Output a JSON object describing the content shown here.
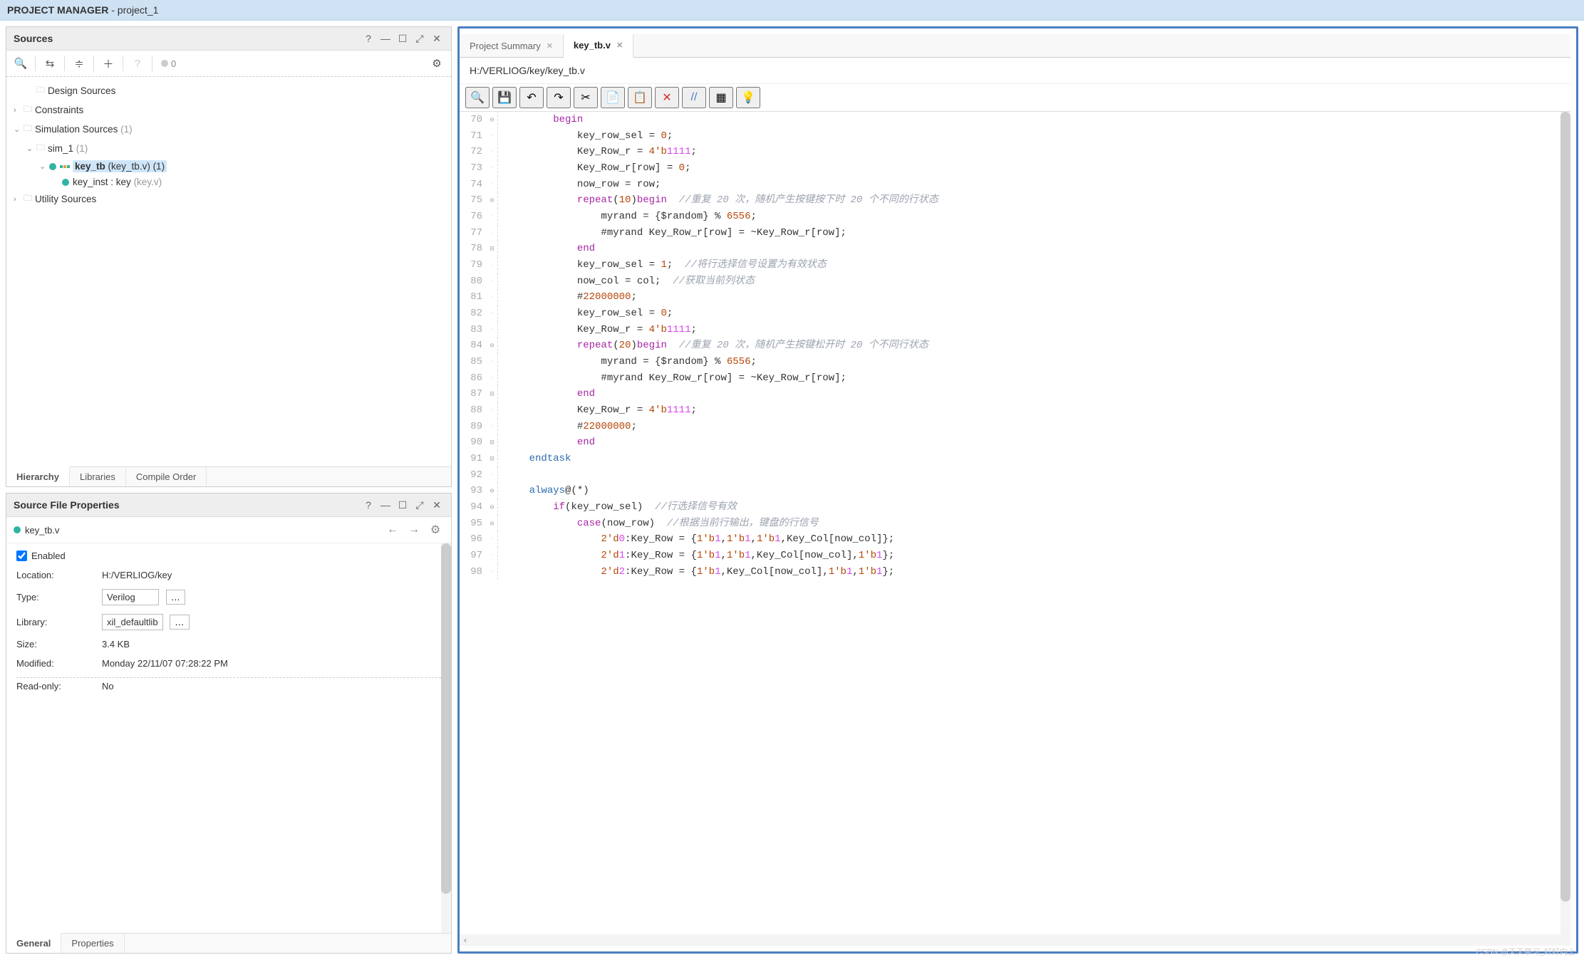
{
  "header": {
    "title_bold": "PROJECT MANAGER",
    "title_rest": " - project_1"
  },
  "sources_panel": {
    "title": "Sources",
    "count_badge": "0",
    "tree": {
      "design_sources": "Design Sources",
      "constraints": "Constraints",
      "simulation_sources": "Simulation Sources",
      "sim_sources_count": "(1)",
      "sim_1": "sim_1",
      "sim_1_count": "(1)",
      "key_tb_name": "key_tb",
      "key_tb_file": "(key_tb.v) (1)",
      "key_inst_name": "key_inst : key",
      "key_inst_file": "(key.v)",
      "utility_sources": "Utility Sources"
    },
    "tabs": {
      "hierarchy": "Hierarchy",
      "libraries": "Libraries",
      "compile_order": "Compile Order"
    }
  },
  "props_panel": {
    "title": "Source File Properties",
    "file_name": "key_tb.v",
    "enabled_label": "Enabled",
    "rows": {
      "location_label": "Location:",
      "location_val": "H:/VERLIOG/key",
      "type_label": "Type:",
      "type_val": "Verilog",
      "library_label": "Library:",
      "library_val": "xil_defaultlib",
      "size_label": "Size:",
      "size_val": "3.4 KB",
      "modified_label": "Modified:",
      "modified_val": "Monday 22/11/07 07:28:22 PM",
      "readonly_label": "Read-only:",
      "readonly_val": "No"
    },
    "tabs": {
      "general": "General",
      "properties": "Properties"
    }
  },
  "editor": {
    "tabs": {
      "project_summary": "Project Summary",
      "key_tb": "key_tb.v"
    },
    "path": "H:/VERLIOG/key/key_tb.v",
    "lines": [
      {
        "n": 70,
        "indent": 2,
        "tokens": [
          {
            "t": "begin",
            "c": "kw-purple"
          }
        ]
      },
      {
        "n": 71,
        "indent": 3,
        "tokens": [
          {
            "t": "key_row_sel = "
          },
          {
            "t": "0",
            "c": "num"
          },
          {
            "t": ";"
          }
        ]
      },
      {
        "n": 72,
        "indent": 3,
        "tokens": [
          {
            "t": "Key_Row_r = "
          },
          {
            "t": "4'b",
            "c": "num"
          },
          {
            "t": "1111",
            "c": "num-bin"
          },
          {
            "t": ";"
          }
        ]
      },
      {
        "n": 73,
        "indent": 3,
        "tokens": [
          {
            "t": "Key_Row_r[row] = "
          },
          {
            "t": "0",
            "c": "num"
          },
          {
            "t": ";"
          }
        ]
      },
      {
        "n": 74,
        "indent": 3,
        "tokens": [
          {
            "t": "now_row = row;"
          }
        ]
      },
      {
        "n": 75,
        "indent": 3,
        "tokens": [
          {
            "t": "repeat",
            "c": "kw-purple"
          },
          {
            "t": "("
          },
          {
            "t": "10",
            "c": "num"
          },
          {
            "t": ")"
          },
          {
            "t": "begin",
            "c": "kw-purple"
          },
          {
            "t": "  "
          },
          {
            "t": "//重复 20 次，随机产生按键按下时 20 个不同的行状态",
            "c": "comment"
          }
        ]
      },
      {
        "n": 76,
        "indent": 4,
        "tokens": [
          {
            "t": "myrand = {$random} % "
          },
          {
            "t": "6556",
            "c": "num"
          },
          {
            "t": ";"
          }
        ]
      },
      {
        "n": 77,
        "indent": 4,
        "tokens": [
          {
            "t": "#myrand Key_Row_r[row] = ~Key_Row_r[row];"
          }
        ]
      },
      {
        "n": 78,
        "indent": 3,
        "tokens": [
          {
            "t": "end",
            "c": "kw-purple"
          }
        ]
      },
      {
        "n": 79,
        "indent": 3,
        "tokens": [
          {
            "t": "key_row_sel = "
          },
          {
            "t": "1",
            "c": "num"
          },
          {
            "t": ";  "
          },
          {
            "t": "//将行选择信号设置为有效状态",
            "c": "comment"
          }
        ]
      },
      {
        "n": 80,
        "indent": 3,
        "tokens": [
          {
            "t": "now_col = col;  "
          },
          {
            "t": "//获取当前列状态",
            "c": "comment"
          }
        ]
      },
      {
        "n": 81,
        "indent": 3,
        "tokens": [
          {
            "t": "#"
          },
          {
            "t": "22000000",
            "c": "num"
          },
          {
            "t": ";"
          }
        ]
      },
      {
        "n": 82,
        "indent": 3,
        "tokens": [
          {
            "t": "key_row_sel = "
          },
          {
            "t": "0",
            "c": "num"
          },
          {
            "t": ";"
          }
        ]
      },
      {
        "n": 83,
        "indent": 3,
        "tokens": [
          {
            "t": "Key_Row_r = "
          },
          {
            "t": "4'b",
            "c": "num"
          },
          {
            "t": "1111",
            "c": "num-bin"
          },
          {
            "t": ";"
          }
        ]
      },
      {
        "n": 84,
        "indent": 3,
        "tokens": [
          {
            "t": "repeat",
            "c": "kw-purple"
          },
          {
            "t": "("
          },
          {
            "t": "20",
            "c": "num"
          },
          {
            "t": ")"
          },
          {
            "t": "begin",
            "c": "kw-purple"
          },
          {
            "t": "  "
          },
          {
            "t": "//重复 20 次，随机产生按键松开时 20 个不同行状态",
            "c": "comment"
          }
        ]
      },
      {
        "n": 85,
        "indent": 4,
        "tokens": [
          {
            "t": "myrand = {$random} % "
          },
          {
            "t": "6556",
            "c": "num"
          },
          {
            "t": ";"
          }
        ]
      },
      {
        "n": 86,
        "indent": 4,
        "tokens": [
          {
            "t": "#myrand Key_Row_r[row] = ~Key_Row_r[row];"
          }
        ]
      },
      {
        "n": 87,
        "indent": 3,
        "tokens": [
          {
            "t": "end",
            "c": "kw-purple"
          }
        ]
      },
      {
        "n": 88,
        "indent": 3,
        "tokens": [
          {
            "t": "Key_Row_r = "
          },
          {
            "t": "4'b",
            "c": "num"
          },
          {
            "t": "1111",
            "c": "num-bin"
          },
          {
            "t": ";"
          }
        ]
      },
      {
        "n": 89,
        "indent": 3,
        "tokens": [
          {
            "t": "#"
          },
          {
            "t": "22000000",
            "c": "num"
          },
          {
            "t": ";"
          }
        ]
      },
      {
        "n": 90,
        "indent": 3,
        "tokens": [
          {
            "t": "end",
            "c": "kw-purple"
          }
        ]
      },
      {
        "n": 91,
        "indent": 1,
        "tokens": [
          {
            "t": "endtask",
            "c": "kw-blue"
          }
        ]
      },
      {
        "n": 92,
        "indent": 1,
        "tokens": [
          {
            "t": ""
          }
        ]
      },
      {
        "n": 93,
        "indent": 1,
        "tokens": [
          {
            "t": "always",
            "c": "kw-blue"
          },
          {
            "t": "@(*)"
          }
        ]
      },
      {
        "n": 94,
        "indent": 2,
        "tokens": [
          {
            "t": "if",
            "c": "kw-purple"
          },
          {
            "t": "(key_row_sel)  "
          },
          {
            "t": "//行选择信号有效",
            "c": "comment"
          }
        ]
      },
      {
        "n": 95,
        "indent": 3,
        "tokens": [
          {
            "t": "case",
            "c": "kw-purple"
          },
          {
            "t": "(now_row)  "
          },
          {
            "t": "//根据当前行输出，键盘的行信号",
            "c": "comment"
          }
        ]
      },
      {
        "n": 96,
        "indent": 4,
        "tokens": [
          {
            "t": "2'd",
            "c": "num"
          },
          {
            "t": "0",
            "c": "num-bin"
          },
          {
            "t": ":Key_Row = {"
          },
          {
            "t": "1'b",
            "c": "num"
          },
          {
            "t": "1",
            "c": "num-bin"
          },
          {
            "t": ","
          },
          {
            "t": "1'b",
            "c": "num"
          },
          {
            "t": "1",
            "c": "num-bin"
          },
          {
            "t": ","
          },
          {
            "t": "1'b",
            "c": "num"
          },
          {
            "t": "1",
            "c": "num-bin"
          },
          {
            "t": ",Key_Col[now_col]};"
          }
        ]
      },
      {
        "n": 97,
        "indent": 4,
        "tokens": [
          {
            "t": "2'd",
            "c": "num"
          },
          {
            "t": "1",
            "c": "num-bin"
          },
          {
            "t": ":Key_Row = {"
          },
          {
            "t": "1'b",
            "c": "num"
          },
          {
            "t": "1",
            "c": "num-bin"
          },
          {
            "t": ","
          },
          {
            "t": "1'b",
            "c": "num"
          },
          {
            "t": "1",
            "c": "num-bin"
          },
          {
            "t": ",Key_Col[now_col],"
          },
          {
            "t": "1'b",
            "c": "num"
          },
          {
            "t": "1",
            "c": "num-bin"
          },
          {
            "t": "};"
          }
        ]
      },
      {
        "n": 98,
        "indent": 4,
        "tokens": [
          {
            "t": "2'd",
            "c": "num"
          },
          {
            "t": "2",
            "c": "num-bin"
          },
          {
            "t": ":Key_Row = {"
          },
          {
            "t": "1'b",
            "c": "num"
          },
          {
            "t": "1",
            "c": "num-bin"
          },
          {
            "t": ",Key_Col[now_col],"
          },
          {
            "t": "1'b",
            "c": "num"
          },
          {
            "t": "1",
            "c": "num-bin"
          },
          {
            "t": ","
          },
          {
            "t": "1'b",
            "c": "num"
          },
          {
            "t": "1",
            "c": "num-bin"
          },
          {
            "t": "};"
          }
        ]
      }
    ]
  },
  "watermark": "CSDN @天天学习_好好向上"
}
